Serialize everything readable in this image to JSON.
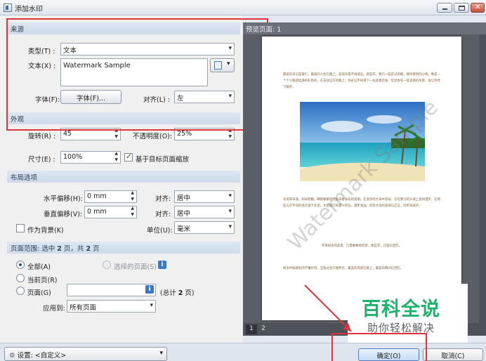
{
  "window": {
    "title": "添加水印"
  },
  "source": {
    "header": "来源",
    "type_label": "类型(T) :",
    "type_value": "文本",
    "text_label": "文本(X) :",
    "text_value": "Watermark Sample",
    "font_label": "字体(F):",
    "font_button": "字体(F)...",
    "align_label": "对齐(L) :",
    "align_value": "左"
  },
  "appearance": {
    "header": "外观",
    "rotation_label": "旋转(R) :",
    "rotation_value": "45",
    "opacity_label": "不透明度(O):",
    "opacity_value": "25%",
    "size_label": "尺寸(E) :",
    "size_value": "100%",
    "scale_label": "基于目标页面缩放",
    "scale_checked": true
  },
  "layout": {
    "header": "布局选项",
    "hoffset_label": "水平偏移(H):",
    "hoffset_value": "0 mm",
    "halign_label": "对齐:",
    "halign_value": "居中",
    "voffset_label": "垂直偏移(V):",
    "voffset_value": "0 mm",
    "valign_label": "对齐:",
    "valign_value": "居中",
    "background_label": "作为背景(K)",
    "background_checked": false,
    "unit_label": "单位(U):",
    "unit_value": "毫米"
  },
  "page_range": {
    "header_prefix": "页面范围: 选中",
    "header_selected": "2",
    "header_mid": "页，共",
    "header_total": "2",
    "header_suffix": "页",
    "all_label": "全部(A)",
    "selected_label": "选择的页面(S)",
    "current_label": "当前页(R)",
    "pages_label": "页面(G)",
    "pages_value": "",
    "total_prefix": "(总计",
    "total_pages": "2",
    "total_suffix": "页)",
    "apply_label": "应用到:",
    "apply_value": "所有页面",
    "info_glyph": "i"
  },
  "preview": {
    "header": "预览页面: 1",
    "watermark_text": "Watermark Sample",
    "paragraph1": "最美的日记是旅行，最美的人生在路上，美丽风景不再遥远。那些年，我们一起走过的路，那时那刻的心情，像是一个个小脑袋挂满的彩色的，在去往远方的路上，你永远不知道下一站会遇见谁，但总会有一些美丽的风景，会让你停下脚步。",
    "paragraph2": "有风和日丽，阳光明媚，细雨蒙蒙的时候去看小岛的美丽。在温热的大海中游泳，在有野马的沙滩上悠闲漫步，在那些与众不同的地方留下足迹，才是旅行的意义所在。漫步海边，欣赏大海的宽阔与辽远，聆听海浪声。",
    "paragraph3": "带来很多的美景，只需静静地欣赏，那些年，已留在回忆。",
    "paragraph4": "很多时候拥有的不懂珍惜，当错过后只能怀念，最美的风景在路上，最美的瞬间在回忆。",
    "page_numbers": [
      "1",
      "2"
    ]
  },
  "bottom": {
    "settings_label": "设置:",
    "settings_value": "<自定义>",
    "ok_button": "确定(O)",
    "cancel_button": "取消(C)"
  },
  "logo": {
    "title": "百科全说",
    "subtitle": "助你轻松解决"
  },
  "colors": {
    "highlight": "#e2323c",
    "group_header": "#cfdbea",
    "preview_bg": "#5a5f66",
    "logo_green": "#1cb36b"
  }
}
